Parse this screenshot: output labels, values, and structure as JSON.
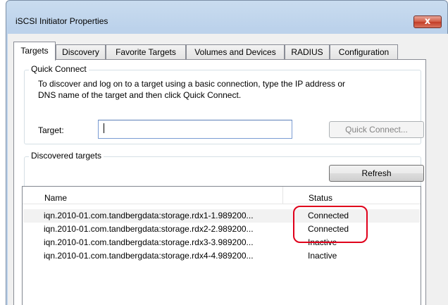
{
  "window": {
    "title": "iSCSI Initiator Properties",
    "close_glyph": "x"
  },
  "tabs": [
    {
      "label": "Targets",
      "active": true
    },
    {
      "label": "Discovery"
    },
    {
      "label": "Favorite Targets"
    },
    {
      "label": "Volumes and Devices"
    },
    {
      "label": "RADIUS"
    },
    {
      "label": "Configuration"
    }
  ],
  "quick_connect": {
    "group_label": "Quick Connect",
    "description_line1": "To discover and log on to a target using a basic connection, type the IP address or",
    "description_line2": "DNS name of the target and then click Quick Connect.",
    "target_label": "Target:",
    "target_value": "",
    "button_label": "Quick Connect..."
  },
  "discovered": {
    "group_label": "Discovered targets",
    "refresh_label": "Refresh",
    "columns": {
      "name": "Name",
      "status": "Status"
    },
    "rows": [
      {
        "name": "iqn.2010-01.com.tandbergdata:storage.rdx1-1.989200...",
        "status": "Connected"
      },
      {
        "name": "iqn.2010-01.com.tandbergdata:storage.rdx2-2.989200...",
        "status": "Connected"
      },
      {
        "name": "iqn.2010-01.com.tandbergdata:storage.rdx3-3.989200...",
        "status": "Inactive"
      },
      {
        "name": "iqn.2010-01.com.tandbergdata:storage.rdx4-4.989200...",
        "status": "Inactive"
      }
    ]
  },
  "colors": {
    "highlight": "#e0001b",
    "close_button": "#c23d27"
  }
}
